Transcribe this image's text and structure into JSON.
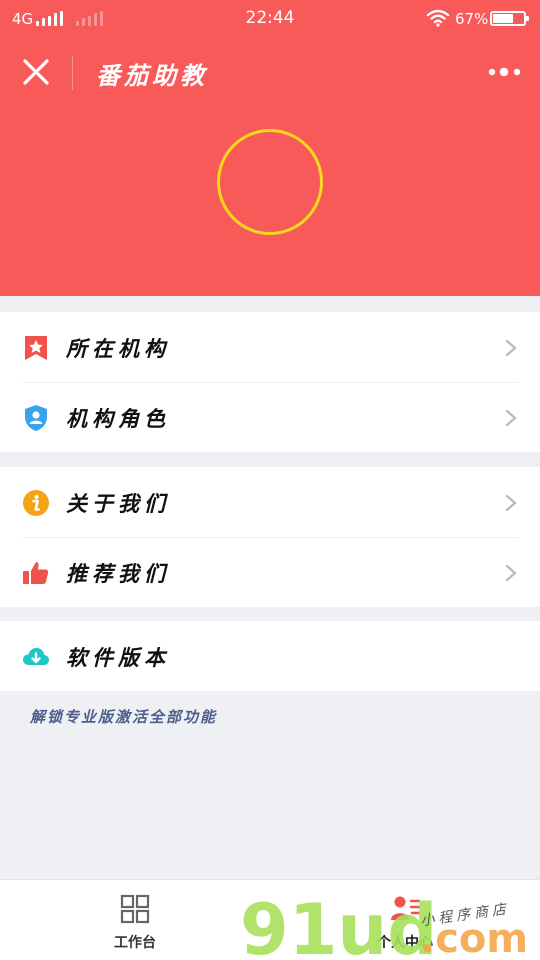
{
  "status_bar": {
    "network": "4G",
    "time": "22:44",
    "battery": "67%",
    "battery_level": 0.67
  },
  "header": {
    "title": "番茄助教",
    "close_icon": "close-icon",
    "more_icon": "more-icon"
  },
  "menu": {
    "groups": [
      [
        {
          "label": "所在机构",
          "icon": "star-bookmark-icon",
          "color": "#f0524c"
        },
        {
          "label": "机构角色",
          "icon": "user-shield-icon",
          "color": "#3aa3ef"
        }
      ],
      [
        {
          "label": "关于我们",
          "icon": "info-icon",
          "color": "#f5a316"
        },
        {
          "label": "推荐我们",
          "icon": "thumbs-up-icon",
          "color": "#f0524c"
        }
      ],
      [
        {
          "label": "软件版本",
          "icon": "cloud-download-icon",
          "color": "#1cc7c4"
        }
      ]
    ]
  },
  "promo_text": "解锁专业版激活全部功能",
  "tabs": [
    {
      "label": "工作台",
      "icon": "grid-icon"
    },
    {
      "label": "个人中心",
      "icon": "user-list-icon"
    }
  ],
  "watermark": {
    "brand": "91ud",
    "suffix": ".com",
    "tagline": "小程序商店"
  },
  "colors": {
    "header_bg": "#f85a59",
    "avatar_ring": "#f6d91c",
    "promo_text": "#4e5f8d"
  }
}
